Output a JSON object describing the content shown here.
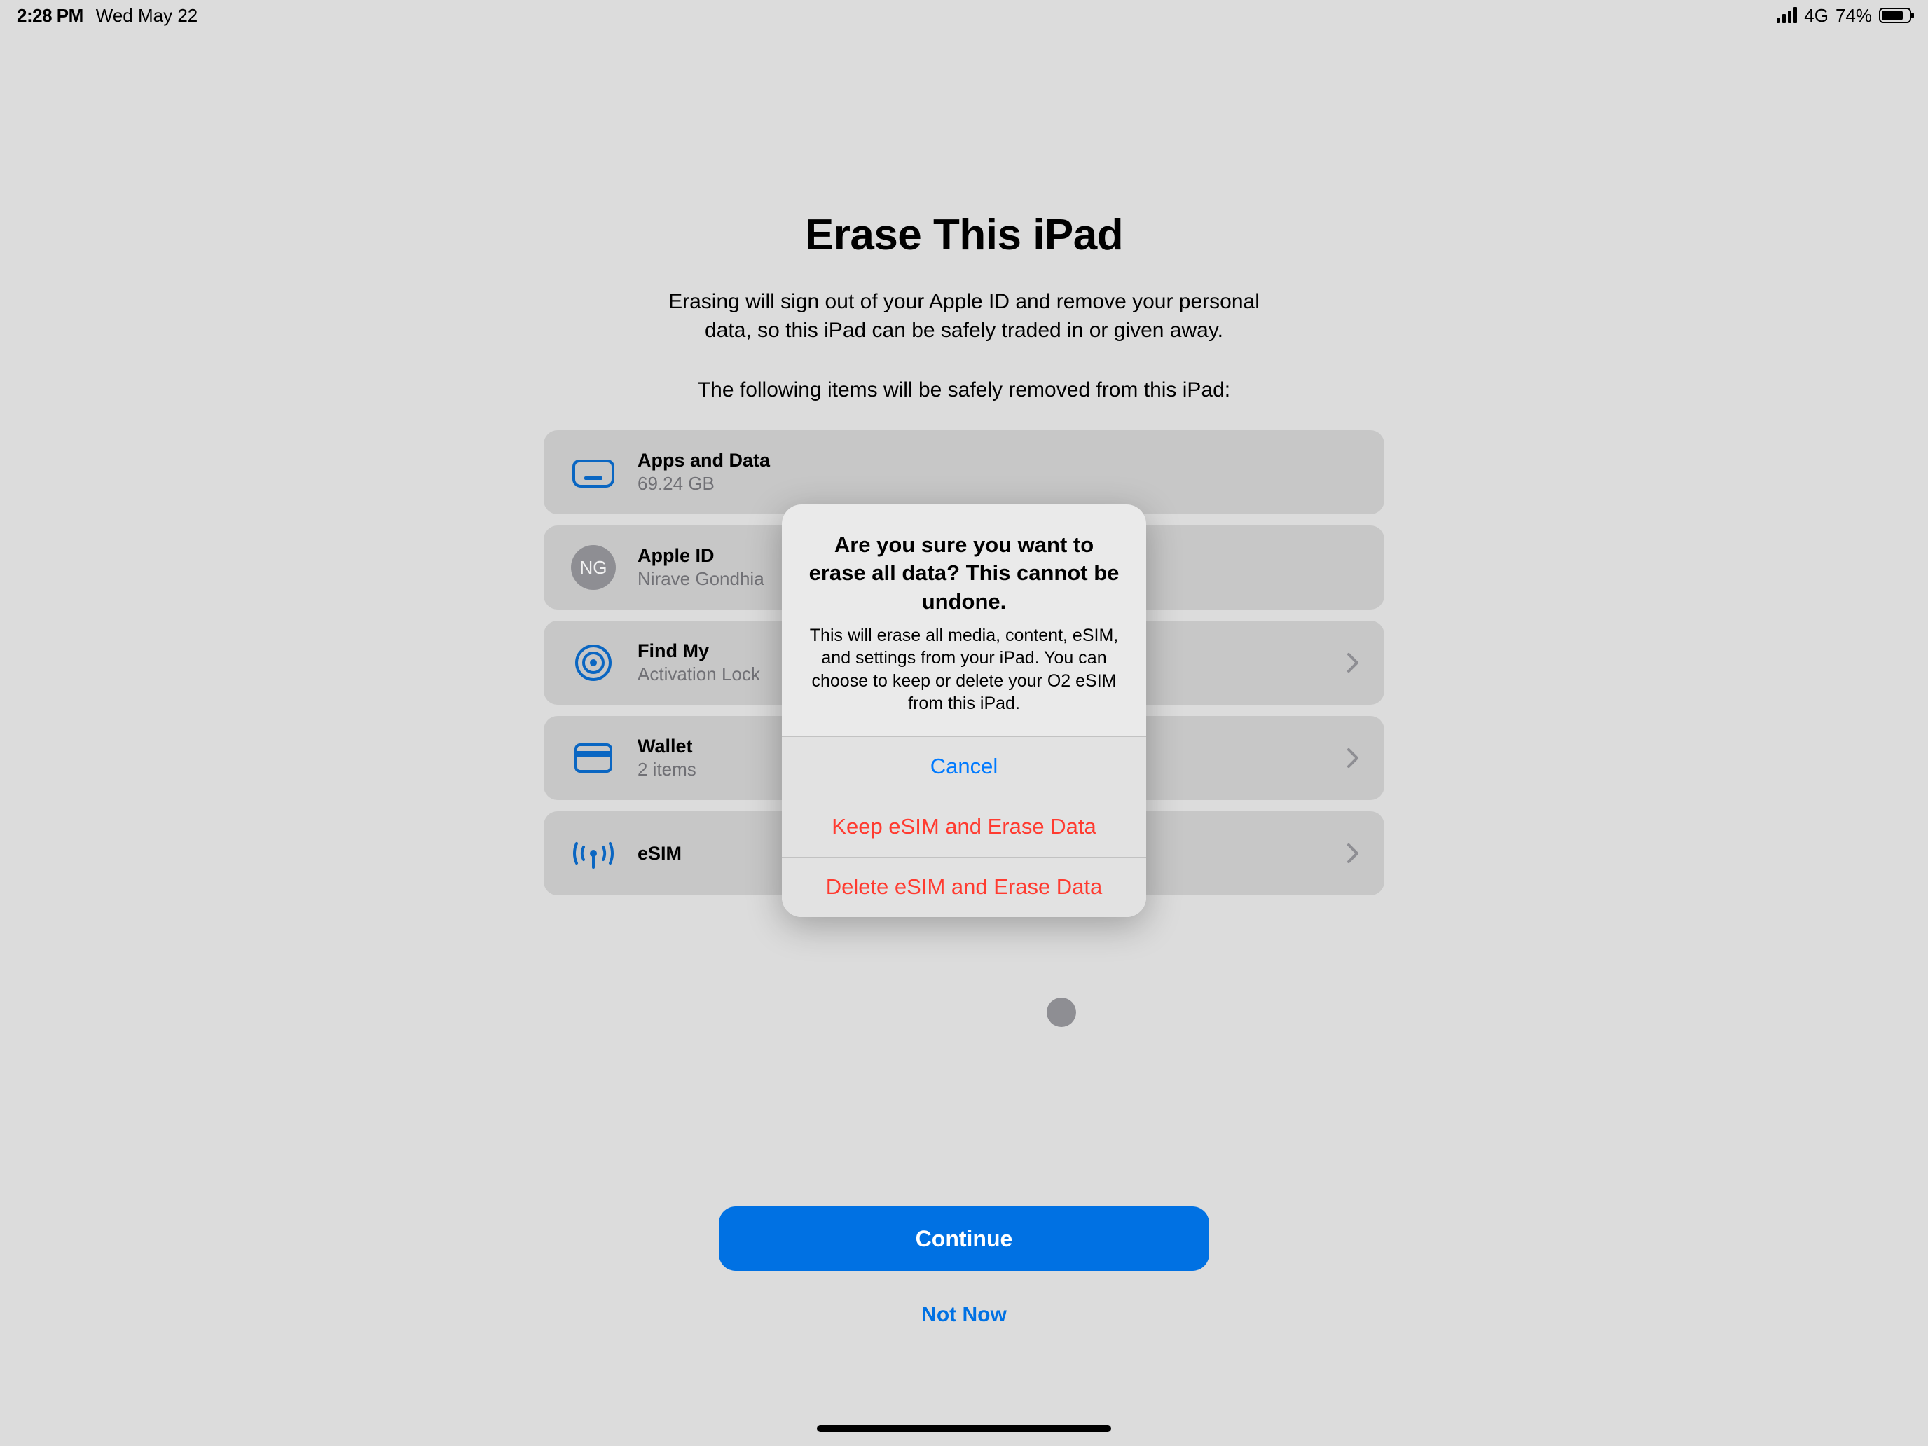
{
  "status_bar": {
    "time": "2:28 PM",
    "date": "Wed May 22",
    "network_type": "4G",
    "battery_text": "74%"
  },
  "page": {
    "title": "Erase This iPad",
    "description": "Erasing will sign out of your Apple ID and remove your personal data, so this iPad can be safely traded in or given away.",
    "subheading": "The following items will be safely removed from this iPad:"
  },
  "items": {
    "apps": {
      "title": "Apps and Data",
      "subtitle": "69.24 GB"
    },
    "apple_id": {
      "title": "Apple ID",
      "subtitle": "Nirave Gondhia",
      "monogram": "NG"
    },
    "find_my": {
      "title": "Find My",
      "subtitle": "Activation Lock"
    },
    "wallet": {
      "title": "Wallet",
      "subtitle": "2 items"
    },
    "esim": {
      "title": "eSIM"
    }
  },
  "buttons": {
    "continue": "Continue",
    "not_now": "Not Now"
  },
  "alert": {
    "title": "Are you sure you want to erase all data? This cannot be undone.",
    "message": "This will erase all media, content, eSIM, and settings from your iPad. You can choose to keep or delete your O2 eSIM from this iPad.",
    "cancel": "Cancel",
    "keep": "Keep eSIM and Erase Data",
    "delete": "Delete eSIM and Erase Data"
  }
}
